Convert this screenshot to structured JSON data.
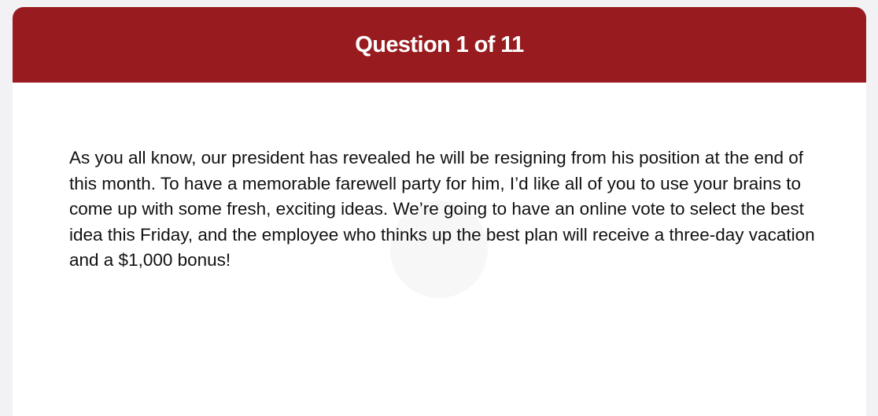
{
  "quiz": {
    "header_title": "Question 1 of 11",
    "question_text": "As you all know, our president has revealed he will be resigning from his position at the end of this month. To have a memorable farewell party for him, I’d like all of you to use your brains to come up with some fresh, exciting ideas. We’re going to have an online vote to select the best idea this Friday, and the employee who thinks up the best plan will receive a three-day vacation and a $1,000 bonus!"
  },
  "colors": {
    "header_background": "#981c1f",
    "header_text": "#ffffff",
    "page_background": "#f2f2f4",
    "card_background": "#ffffff",
    "body_text": "#111111"
  }
}
